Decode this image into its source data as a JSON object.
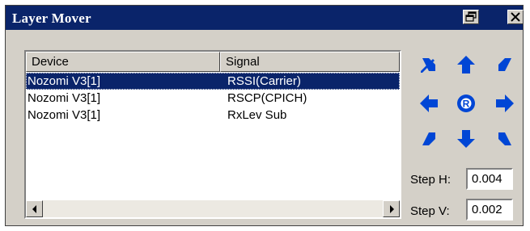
{
  "window": {
    "title": "Layer Mover"
  },
  "list": {
    "columns": [
      "Device",
      "Signal"
    ],
    "rows": [
      {
        "device": "Nozomi V3[1]",
        "signal": "RSSI(Carrier)",
        "selected": true
      },
      {
        "device": "Nozomi V3[1]",
        "signal": "RSCP(CPICH)",
        "selected": false
      },
      {
        "device": "Nozomi V3[1]",
        "signal": "RxLev Sub",
        "selected": false
      }
    ]
  },
  "pad": {
    "center_label": "R",
    "arrow_color": "#0046d5"
  },
  "step": {
    "h_label": "Step H:",
    "h_value": "0.004",
    "v_label": "Step V:",
    "v_value": "0.002"
  }
}
